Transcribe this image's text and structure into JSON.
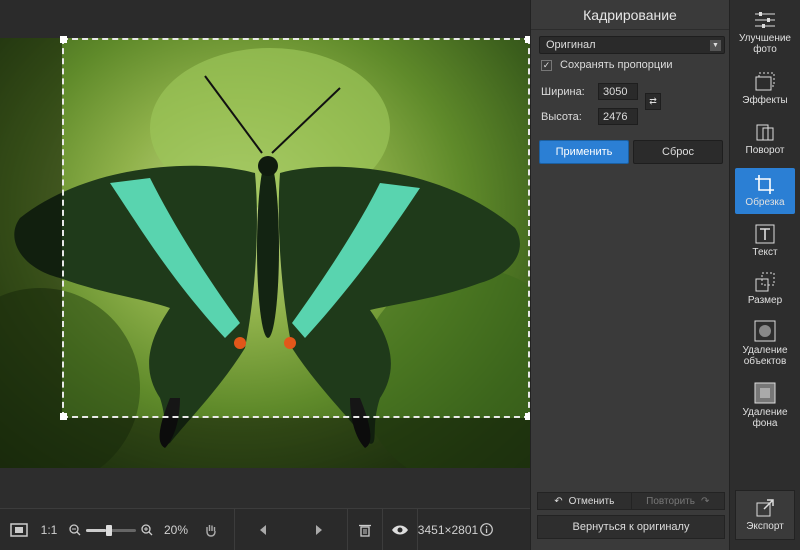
{
  "panel": {
    "title": "Кадрирование",
    "preset_value": "Оригинал",
    "keep_ratio_label": "Сохранять пропорции",
    "keep_ratio_checked": true,
    "width_label": "Ширина:",
    "width_value": "3050",
    "height_label": "Высота:",
    "height_value": "2476",
    "apply_label": "Применить",
    "reset_label": "Сброс",
    "undo_label": "Отменить",
    "redo_label": "Повторить",
    "revert_label": "Вернуться к оригиналу"
  },
  "tools": [
    {
      "label": "Улучшение фото",
      "icon": "sliders-icon"
    },
    {
      "label": "Эффекты",
      "icon": "effects-icon"
    },
    {
      "label": "Поворот",
      "icon": "rotate-icon"
    },
    {
      "label": "Обрезка",
      "icon": "crop-icon",
      "active": true
    },
    {
      "label": "Текст",
      "icon": "text-icon"
    },
    {
      "label": "Размер",
      "icon": "resize-icon"
    },
    {
      "label": "Удаление объектов",
      "icon": "object-removal-icon"
    },
    {
      "label": "Удаление фона",
      "icon": "background-removal-icon"
    }
  ],
  "export_label": "Экспорт",
  "bottom_bar": {
    "actual_size_label": "1:1",
    "zoom_percent": "20%",
    "zoom_level": 0.2,
    "image_size": "3451×2801"
  },
  "colors": {
    "accent": "#2b7fd4",
    "panel_bg": "#3a3a3a",
    "sidebar_bg": "#2d2d2d"
  }
}
